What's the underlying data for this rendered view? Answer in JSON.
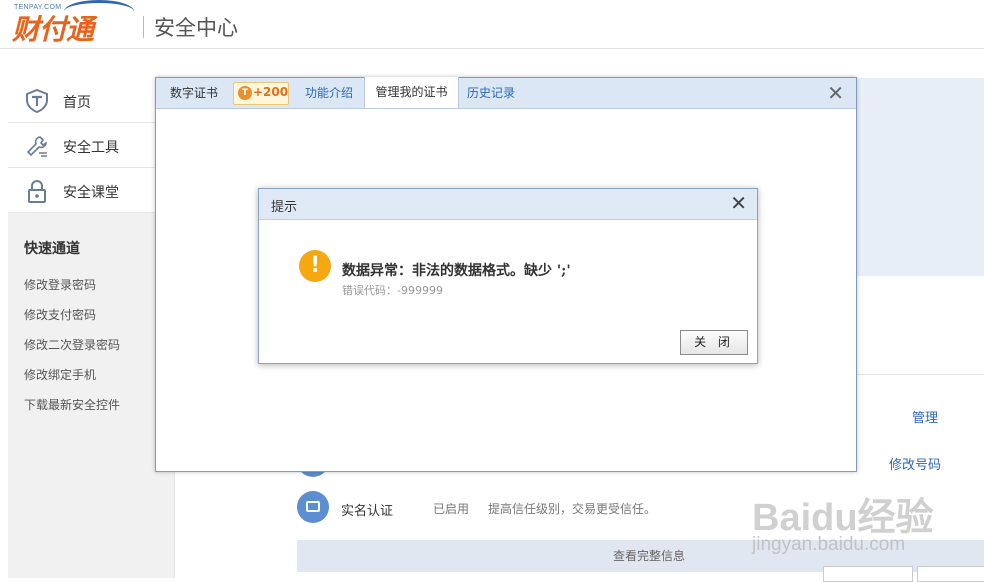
{
  "header": {
    "logo_small": "TENPAY.COM",
    "logo_text": "财付通",
    "title": "安全中心"
  },
  "sidebar": {
    "nav": [
      {
        "label": "首页",
        "icon": "shield-t-icon"
      },
      {
        "label": "安全工具",
        "icon": "wrench-icon"
      },
      {
        "label": "安全课堂",
        "icon": "lock-icon"
      }
    ],
    "quick_title": "快速通道",
    "quick_links": [
      "修改登录密码",
      "修改支付密码",
      "修改二次登录密码",
      "修改绑定手机",
      "下载最新安全控件"
    ]
  },
  "main": {
    "manage_link": "管理",
    "modify_link": "修改号码",
    "realname_label": "实名认证",
    "realname_status": "已启用",
    "realname_desc": "提高信任级别，交易更受信任。",
    "view_full": "查看完整信息"
  },
  "cert_dialog": {
    "tabs": {
      "digital": "数字证书",
      "badge_value": "+200",
      "badge_icon": "T",
      "intro": "功能介绍",
      "manage": "管理我的证书",
      "history": "历史记录"
    },
    "close": "✕"
  },
  "alert": {
    "title": "提示",
    "close": "✕",
    "icon": "!",
    "message": "数据异常：非法的数据格式。缺少 ';'",
    "code": "错误代码：-999999",
    "button": "关 闭"
  },
  "watermark": {
    "brand": "Baidu经验",
    "url": "jingyan.baidu.com"
  },
  "colors": {
    "brand_orange": "#e8641c",
    "link_blue": "#2d68b8",
    "warning": "#f5a811"
  }
}
